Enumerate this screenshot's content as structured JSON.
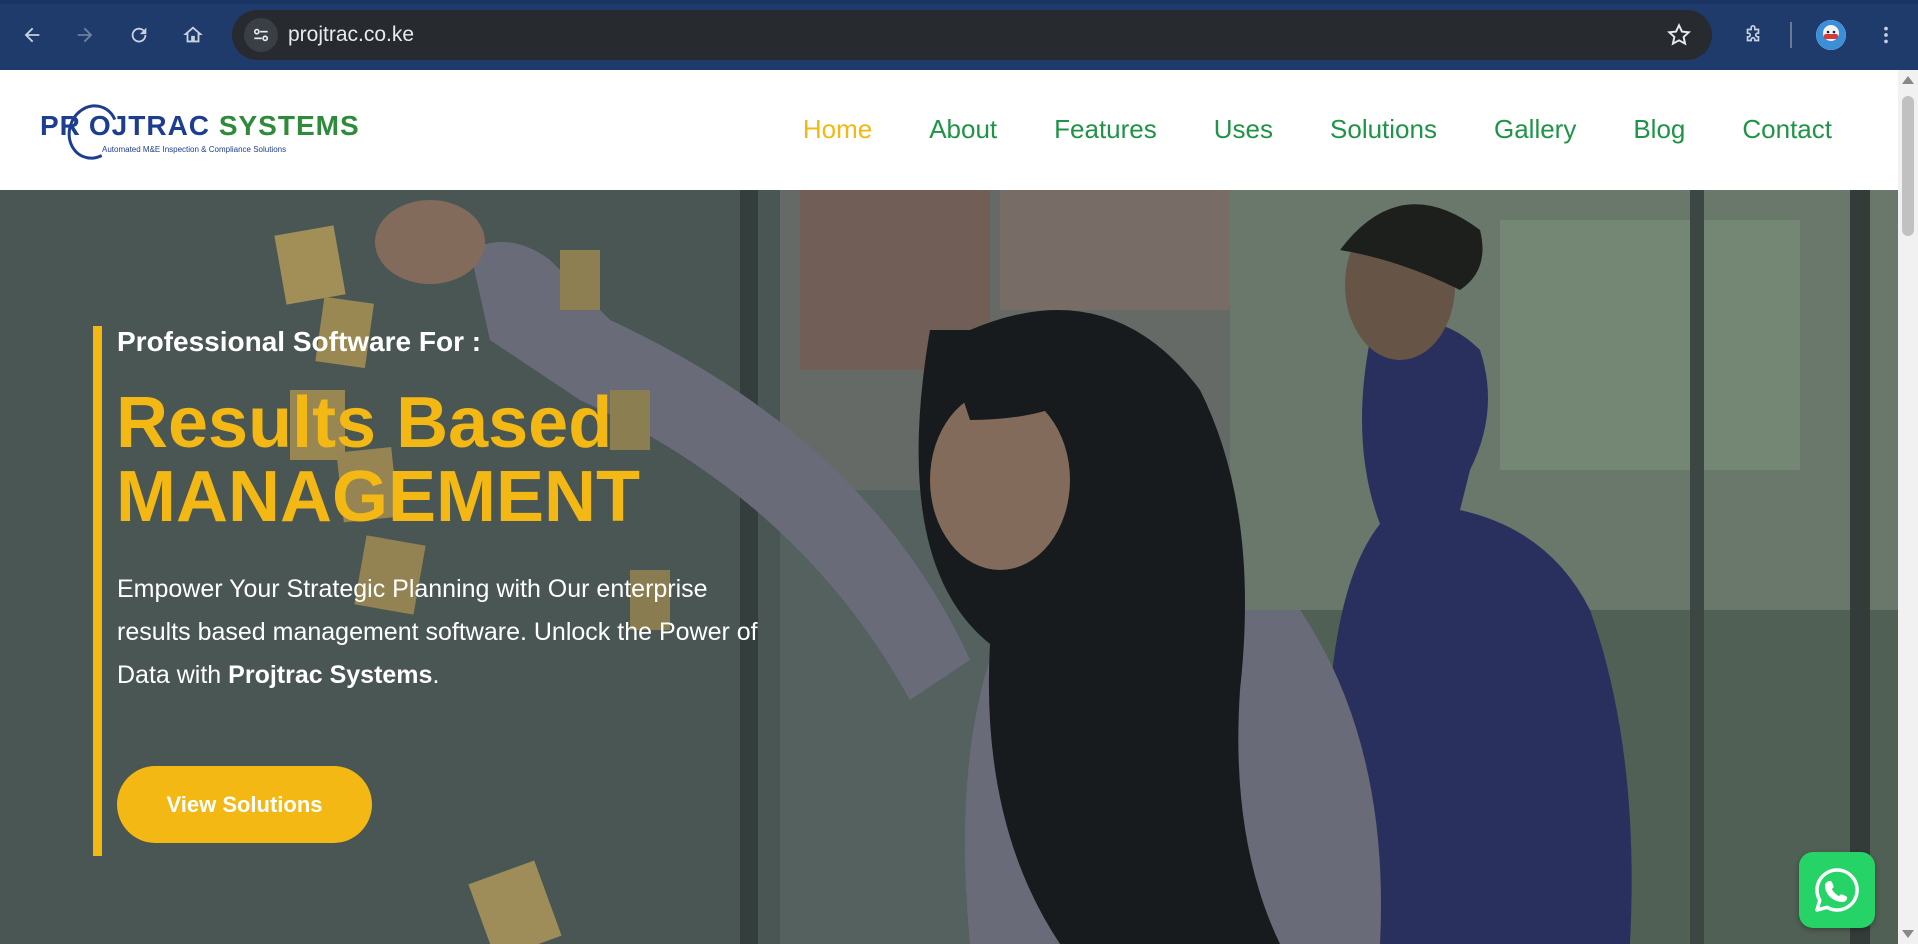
{
  "browser": {
    "url": "projtrac.co.ke",
    "icons": [
      "back-icon",
      "forward-icon",
      "reload-icon",
      "home-icon",
      "site-info-icon",
      "star-icon",
      "extensions-icon",
      "profile-avatar",
      "menu-icon"
    ]
  },
  "site": {
    "logo": {
      "text_part1": "PR",
      "text_part2": "OJTRAC",
      "text_part3": "SYSTEMS",
      "tagline": "Automated M&E  Inspection & Compliance Solutions"
    },
    "nav": [
      {
        "label": "Home",
        "active": true
      },
      {
        "label": "About",
        "active": false
      },
      {
        "label": "Features",
        "active": false
      },
      {
        "label": "Uses",
        "active": false
      },
      {
        "label": "Solutions",
        "active": false
      },
      {
        "label": "Gallery",
        "active": false
      },
      {
        "label": "Blog",
        "active": false
      },
      {
        "label": "Contact",
        "active": false
      }
    ]
  },
  "hero": {
    "kicker": "Professional Software For :",
    "headline_line1": "Results Based",
    "headline_line2": "MANAGEMENT",
    "lede_text": "Empower Your Strategic Planning with Our enterprise results based management software. Unlock the Power of Data with ",
    "lede_bold": "Projtrac Systems",
    "lede_end": ".",
    "cta_label": "View Solutions"
  },
  "widgets": {
    "whatsapp_icon": "whatsapp-icon"
  },
  "colors": {
    "chrome_bg": "#1f3b6b",
    "accent": "#f3b814",
    "nav_green": "#1f9448",
    "logo_blue": "#1d3d8f"
  }
}
